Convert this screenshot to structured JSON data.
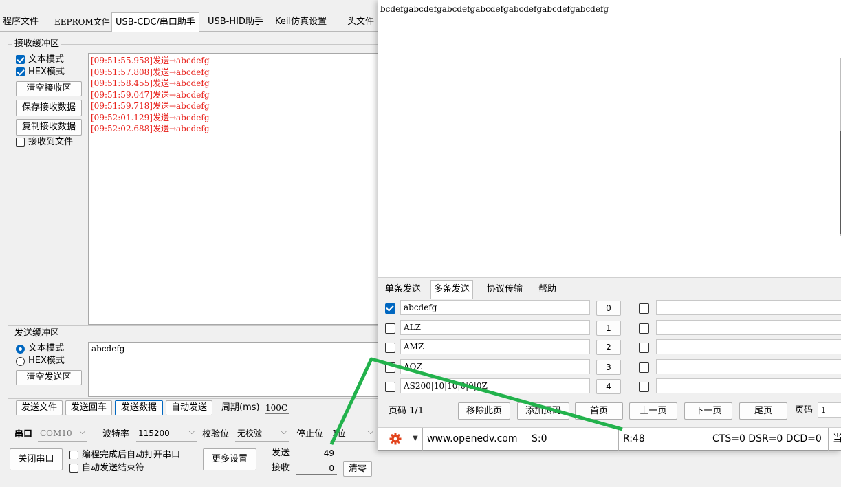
{
  "left": {
    "tabs": [
      "程序文件",
      "EEPROM文件",
      "USB-CDC/串口助手",
      "USB-HID助手",
      "Keil仿真设置",
      "头文件"
    ],
    "rx": {
      "group_title": "接收缓冲区",
      "text_mode": "文本模式",
      "hex_mode": "HEX模式",
      "clear_btn": "清空接收区",
      "save_btn": "保存接收数据",
      "copy_btn": "复制接收数据",
      "to_file": "接收到文件",
      "lines": [
        "[09:51:55.958]发送→abcdefg",
        "[09:51:57.808]发送→abcdefg",
        "[09:51:58.455]发送→abcdefg",
        "[09:51:59.047]发送→abcdefg",
        "[09:51:59.718]发送→abcdefg",
        "[09:52:01.129]发送→abcdefg",
        "[09:52:02.688]发送→abcdefg"
      ]
    },
    "tx": {
      "group_title": "发送缓冲区",
      "text_mode": "文本模式",
      "hex_mode": "HEX模式",
      "clear_btn": "清空发送区",
      "content": "abcdefg"
    },
    "actions": {
      "send_file": "发送文件",
      "send_enter": "发送回车",
      "send_data": "发送数据",
      "auto_send": "自动发送",
      "period_label": "周期(ms)",
      "period_value": "100C"
    },
    "port": {
      "port_label": "串口",
      "port_value": "COM10",
      "baud_label": "波特率",
      "baud_value": "115200",
      "parity_label": "校验位",
      "parity_value": "无校验",
      "stop_label": "停止位",
      "stop_value": "1位",
      "close_btn": "关闭串口",
      "auto_open": "编程完成后自动打开串口",
      "auto_end": "自动发送结束符",
      "more_btn": "更多设置",
      "sent_label": "发送",
      "sent_value": "49",
      "recv_label": "接收",
      "recv_value": "0",
      "clear_count_btn": "清零"
    }
  },
  "right": {
    "rx_text": "bcdefgabcdefgabcdefgabcdefgabcdefgabcdefgabcdefg",
    "tabs": [
      "单条发送",
      "多条发送",
      "协议传输",
      "帮助"
    ],
    "rows": [
      {
        "text": "abcdefg",
        "num": "0",
        "checked": true
      },
      {
        "text": "ALZ",
        "num": "1",
        "checked": false
      },
      {
        "text": "AMZ",
        "num": "2",
        "checked": false
      },
      {
        "text": "AQZ",
        "num": "3",
        "checked": false
      },
      {
        "text": "AS200|10|10|0|0|0Z",
        "num": "4",
        "checked": false
      }
    ],
    "pager": {
      "page_info": "页码 1/1",
      "remove_btn": "移除此页",
      "add_btn": "添加页码",
      "first_btn": "首页",
      "prev_btn": "上一页",
      "next_btn": "下一页",
      "last_btn": "尾页",
      "page_label": "页码",
      "page_value": "1"
    },
    "status": {
      "url": "www.openedv.com",
      "sent": "S:0",
      "recv": "R:48",
      "lines": "CTS=0 DSR=0 DCD=0",
      "tail": "当"
    }
  },
  "annotation_color": "#22b24c",
  "accent_color": "#0067c0",
  "rx_text_color": "#e8221c"
}
